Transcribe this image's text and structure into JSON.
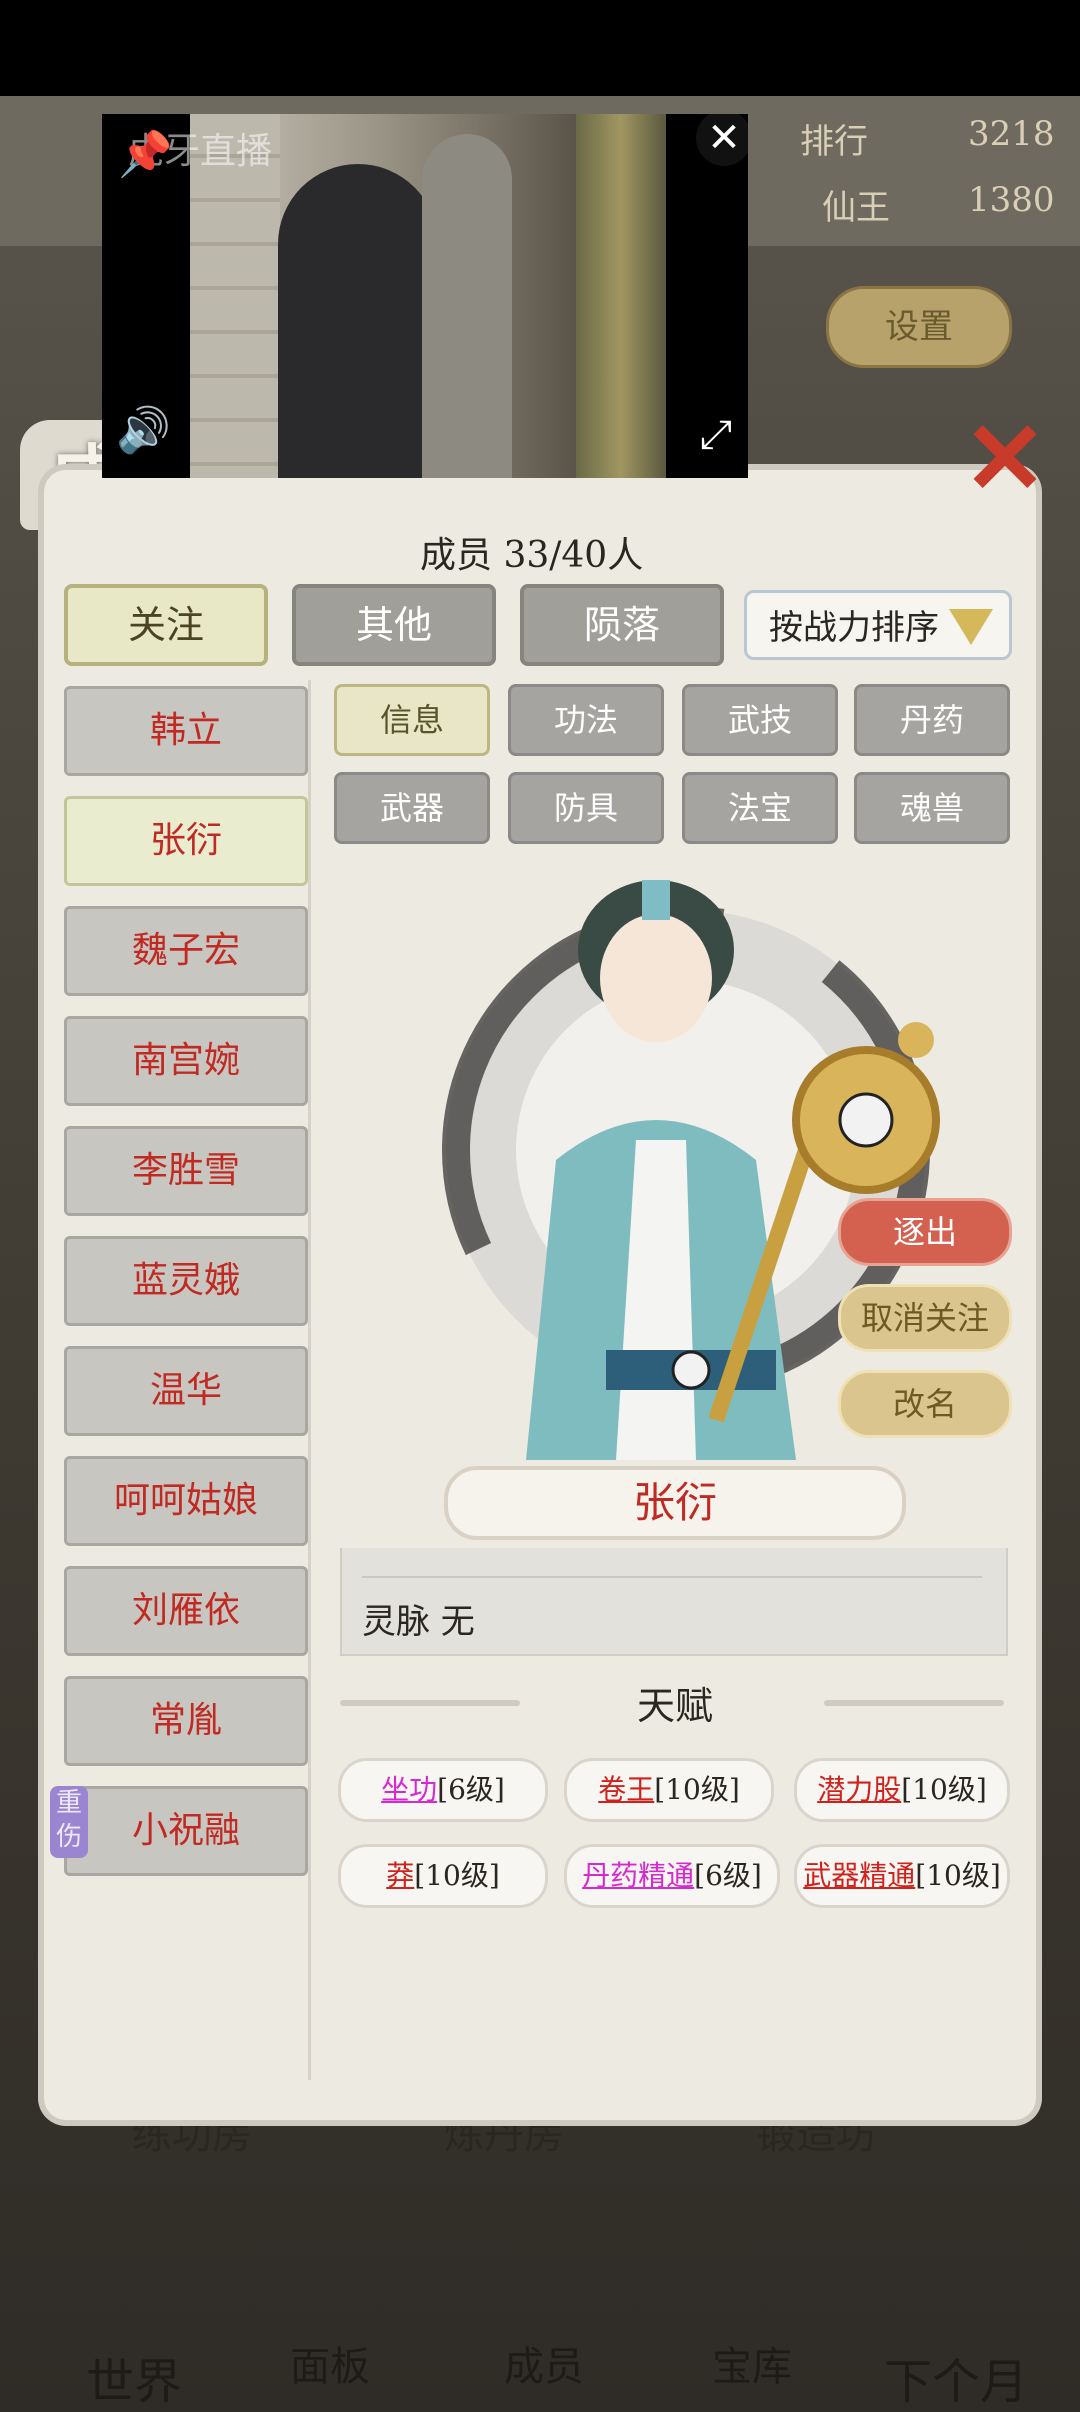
{
  "background": {
    "rank_label": "排行",
    "rank_value": "3218",
    "title_label": "仙王",
    "title_value": "1380",
    "settings_label": "设置",
    "rooms": [
      "练功房",
      "炼丹房",
      "锻造坊"
    ],
    "bottom_tabs": [
      "世界",
      "面板",
      "成员",
      "宝库",
      "下个月"
    ]
  },
  "video": {
    "watermark": "虎牙直播",
    "pin_icon": "pin-icon",
    "close_icon": "close-icon",
    "volume_icon": "volume-icon",
    "fullscreen_icon": "fullscreen-icon"
  },
  "panel": {
    "title": "成员",
    "member_count": "成员  33/40人",
    "filter_tabs": [
      "关注",
      "其他",
      "陨落"
    ],
    "active_filter": "关注",
    "sort_label": "按战力排序",
    "members": [
      {
        "name": "韩立",
        "active": false
      },
      {
        "name": "张衍",
        "active": true
      },
      {
        "name": "魏子宏",
        "active": false
      },
      {
        "name": "南宫婉",
        "active": false
      },
      {
        "name": "李胜雪",
        "active": false
      },
      {
        "name": "蓝灵娥",
        "active": false
      },
      {
        "name": "温华",
        "active": false
      },
      {
        "name": "呵呵姑娘",
        "active": false
      },
      {
        "name": "刘雁依",
        "active": false
      },
      {
        "name": "常胤",
        "active": false
      },
      {
        "name": "小祝融",
        "active": false,
        "badge": "重伤"
      }
    ],
    "detail_tabs": [
      "信息",
      "功法",
      "武技",
      "丹药",
      "武器",
      "防具",
      "法宝",
      "魂兽"
    ],
    "active_detail_tab": "信息",
    "actions": {
      "expel": "逐出",
      "unfollow": "取消关注",
      "rename": "改名"
    },
    "selected_name": "张衍",
    "info_rows": {
      "spirit_vein": "灵脉  无"
    },
    "talent_title": "天赋",
    "talents": [
      {
        "name": "坐功",
        "level": "[6级]",
        "color": "#d62ad0"
      },
      {
        "name": "卷王",
        "level": "[10级]",
        "color": "#d0221c"
      },
      {
        "name": "潜力股",
        "level": "[10级]",
        "color": "#d0221c"
      },
      {
        "name": "莽",
        "level": "[10级]",
        "color": "#d0221c"
      },
      {
        "name": "丹药精通",
        "level": "[6级]",
        "color": "#d62ad0"
      },
      {
        "name": "武器精通",
        "level": "[10级]",
        "color": "#d0221c"
      }
    ]
  }
}
